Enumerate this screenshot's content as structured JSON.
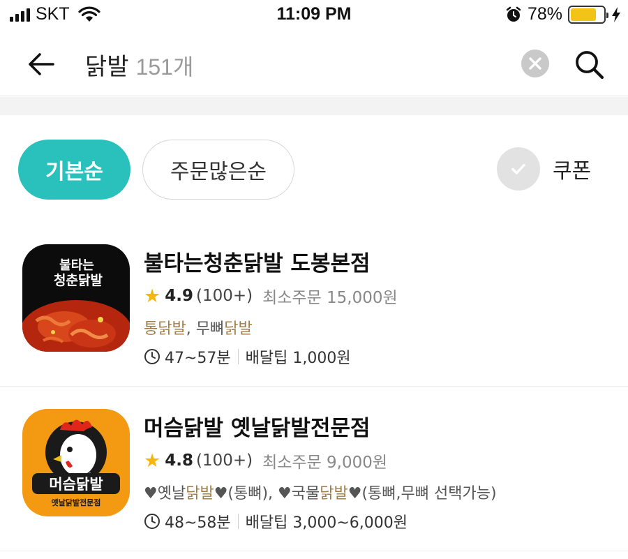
{
  "status_bar": {
    "carrier": "SKT",
    "time": "11:09 PM",
    "battery_percent": "78%",
    "battery_level": 0.78,
    "icons": [
      "signal-icon",
      "wifi-icon",
      "alarm-icon",
      "battery-icon",
      "charging-icon"
    ]
  },
  "search": {
    "query": "닭발",
    "result_count": "151개",
    "icons": [
      "back-arrow-icon",
      "clear-icon",
      "search-icon"
    ]
  },
  "filters": {
    "sort_default": "기본순",
    "sort_orders": "주문많은순",
    "coupon": "쿠폰"
  },
  "colors": {
    "accent": "#2ac1bc",
    "star": "#f6b60f",
    "menu_highlight": "#a07e4b"
  },
  "restaurants": [
    {
      "name": "불타는청춘닭발 도봉본점",
      "rating": "4.9",
      "reviews": "(100+)",
      "min_order": "최소주문 15,000원",
      "menu_parts": [
        "통닭발",
        ", 무뼈",
        "닭발"
      ],
      "delivery_time": "47~57분",
      "delivery_tip": "배달팁 1,000원",
      "logo_text_lines": [
        "불타는",
        "청춘닭발"
      ]
    },
    {
      "name": "머슴닭발 옛날닭발전문점",
      "rating": "4.8",
      "reviews": "(100+)",
      "min_order": "최소주문 9,000원",
      "menu_parts": [
        "♥옛날",
        "닭발",
        "♥(통뼈), ♥국물",
        "닭발",
        "♥(통뼈,무뼈 선택가능)"
      ],
      "delivery_time": "48~58분",
      "delivery_tip": "배달팁 3,000~6,000원",
      "logo_text_main": "머슴닭발",
      "logo_text_sub": "옛날닭발전문점"
    }
  ]
}
